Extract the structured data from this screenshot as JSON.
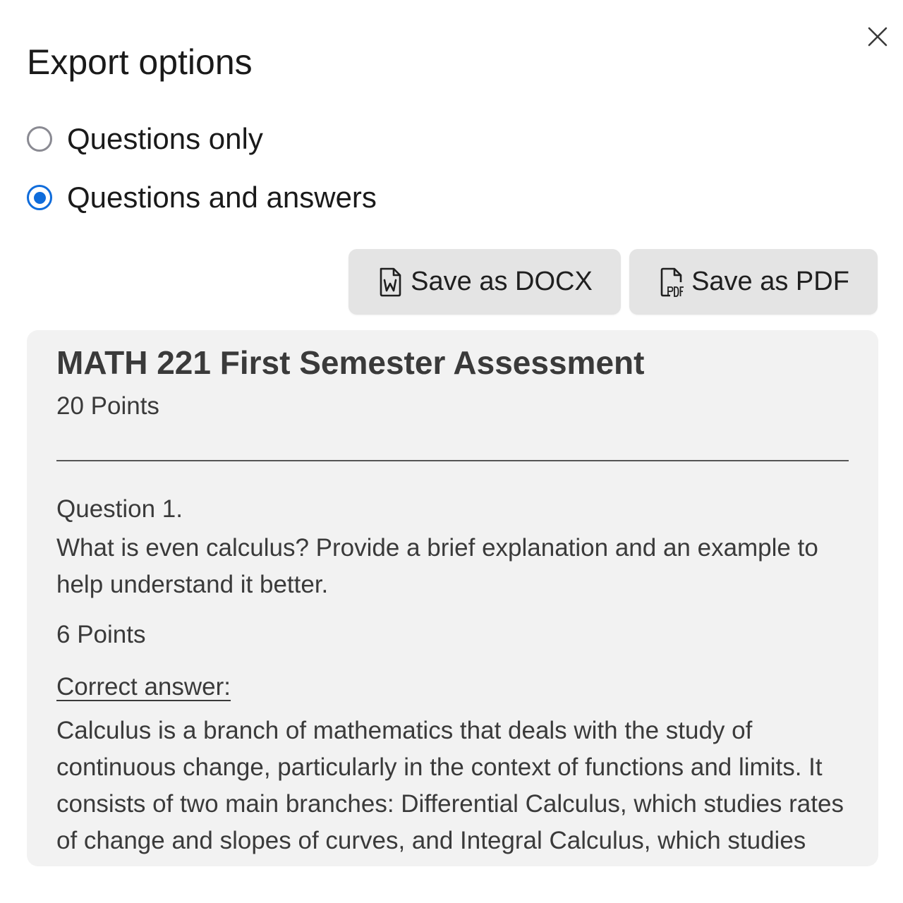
{
  "dialog": {
    "title": "Export options",
    "close_icon": "close-icon"
  },
  "options": [
    {
      "label": "Questions only",
      "selected": false
    },
    {
      "label": "Questions and answers",
      "selected": true
    }
  ],
  "actions": {
    "docx_label": "Save as DOCX",
    "docx_icon": "word-file-icon",
    "pdf_label": "Save as PDF",
    "pdf_icon": "pdf-file-icon"
  },
  "preview": {
    "title": "MATH 221 First Semester Assessment",
    "total_points": "20 Points",
    "questions": [
      {
        "heading": "Question 1.",
        "text": "What is even calculus? Provide a brief explanation and an example to help understand it better.",
        "points": "6 Points",
        "answer_label": "Correct answer:",
        "answer": "Calculus is a branch of mathematics that deals with the study of continuous change, particularly in the context of functions and limits. It consists of two main branches: Differential Calculus, which studies rates of change and slopes of curves, and Integral Calculus, which studies accumulation of quantities and areas under curves."
      }
    ]
  },
  "colors": {
    "accent": "#0f6cdb",
    "button_bg": "#e4e4e4",
    "preview_bg": "#f2f2f2",
    "preview_text": "#3a3a3a"
  }
}
